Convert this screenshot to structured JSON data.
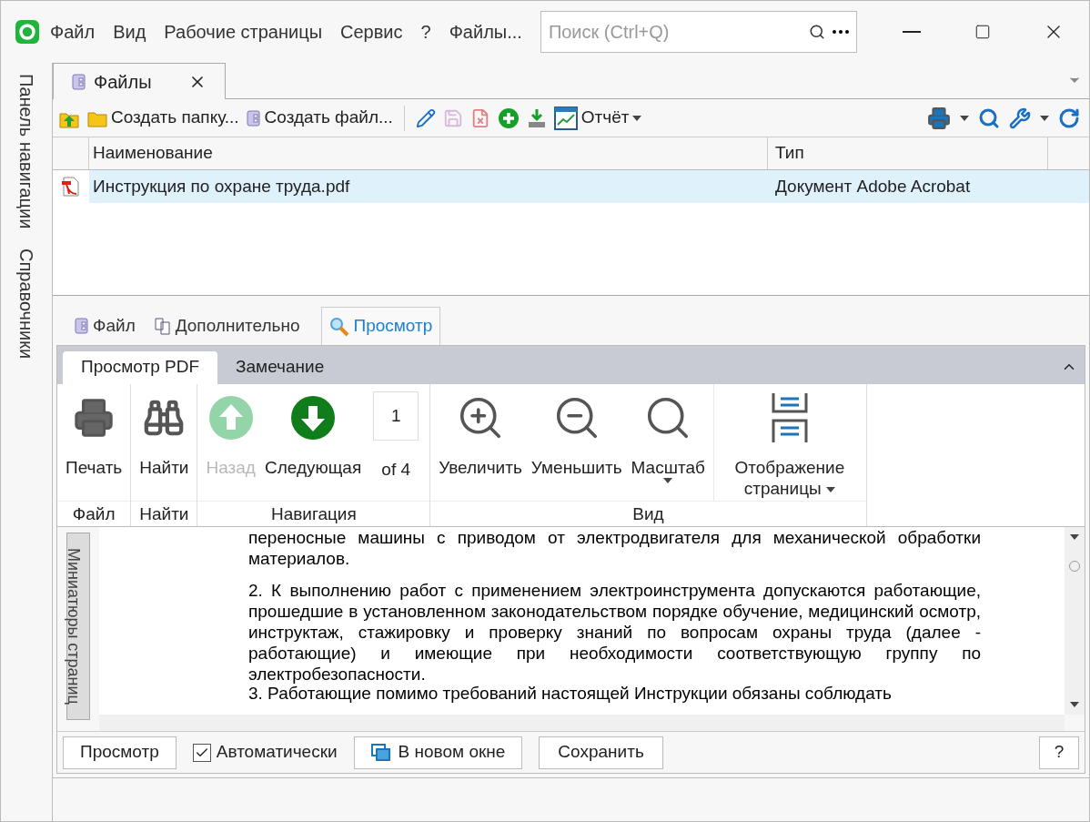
{
  "menu": [
    "Файл",
    "Вид",
    "Рабочие страницы",
    "Сервис",
    "?",
    "Файлы..."
  ],
  "search": {
    "placeholder": "Поиск (Ctrl+Q)"
  },
  "nav_panel": [
    "Панель навигации",
    "Справочники"
  ],
  "doc_tabs": [
    {
      "label": "Файлы",
      "selected": true
    }
  ],
  "toolbar": {
    "left": [
      "Создать папку...",
      "Создать файл..."
    ],
    "report": "Отчёт"
  },
  "table": {
    "columns": [
      "Наименование",
      "Тип"
    ],
    "rows": [
      {
        "cells": [
          "Инструкция по охране труда.pdf",
          "Документ Adobe Acrobat"
        ],
        "selected": true
      }
    ]
  },
  "lower_tabs": [
    {
      "label": "Файл",
      "selected": false
    },
    {
      "label": "Дополнительно",
      "selected": false
    },
    {
      "label": "Просмотр",
      "selected": true
    }
  ],
  "ribbon": {
    "tabs": [
      {
        "label": "Просмотр PDF",
        "selected": true
      },
      {
        "label": "Замечание",
        "selected": false
      }
    ],
    "groups": [
      {
        "label": "Файл",
        "items": [
          {
            "kind": "print",
            "label": "Печать",
            "disabled": false
          }
        ]
      },
      {
        "label": "Найти",
        "items": [
          {
            "kind": "find",
            "label": "Найти",
            "disabled": false
          }
        ]
      },
      {
        "label": "Навигация",
        "items": [
          {
            "kind": "back",
            "label": "Назад",
            "disabled": true
          },
          {
            "kind": "next",
            "label": "Следующая",
            "disabled": false
          },
          {
            "kind": "page",
            "value": "1",
            "label": "of 4"
          }
        ]
      },
      {
        "label": "Вид",
        "items": [
          {
            "kind": "zoom-in",
            "label": "Увеличить",
            "disabled": false
          },
          {
            "kind": "zoom-out",
            "label": "Уменьшить",
            "disabled": false
          },
          {
            "kind": "scale",
            "label": "Масштаб",
            "disabled": false
          },
          {
            "kind": "layout",
            "label": "Отображение страницы",
            "disabled": false
          }
        ]
      }
    ]
  },
  "pdf": {
    "side_tab": "Миниатюры страниц",
    "paragraphs": [
      "переносные машины с приводом от электродвигателя для механической обработки материалов.",
      "2. К выполнению работ с применением электроинструмента допускаются работающие, прошедшие в установленном законодательством порядке обучение, медицинский осмотр, инструктаж, стажировку и проверку знаний по вопросам охраны труда (далее - работающие) и имеющие при необходимости соответствующую группу по электробезопасности.",
      "3. Работающие помимо требований настоящей Инструкции обязаны соблюдать"
    ]
  },
  "bottom": {
    "preview": "Просмотр",
    "auto": {
      "label": "Автоматически",
      "checked": true
    },
    "new_window": "В новом окне",
    "save": "Сохранить",
    "help": "?"
  }
}
